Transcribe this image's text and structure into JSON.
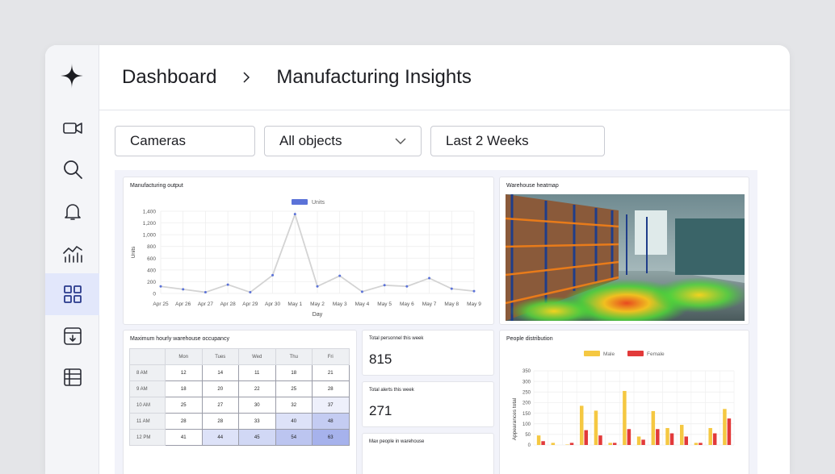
{
  "breadcrumb": {
    "root": "Dashboard",
    "current": "Manufacturing Insights"
  },
  "filters": {
    "cameras": "Cameras",
    "objects": "All objects",
    "range": "Last 2 Weeks"
  },
  "sidebar": {
    "icons": [
      "camera-icon",
      "search-icon",
      "bell-icon",
      "analytics-icon",
      "grid-icon",
      "archive-icon",
      "table-icon"
    ],
    "active": "grid-icon"
  },
  "colors": {
    "active_bg": "#e2e7fb",
    "line_series": "#d3d3d3",
    "point": "#5b72d8",
    "male": "#f5c842",
    "female": "#e23a3a"
  },
  "cards": {
    "output_title": "Manufacturing output",
    "heatmap_title": "Warehouse heatmap",
    "occupancy_title": "Maximum hourly warehouse occupancy",
    "personnel_title": "Total personnel this week",
    "personnel_value": "815",
    "alerts_title": "Total alerts this week",
    "alerts_value": "271",
    "maxpeople_title": "Max people in warehouse",
    "people_title": "People distribution"
  },
  "occupancy": {
    "days": [
      "Mon",
      "Tues",
      "Wed",
      "Thu",
      "Fri"
    ],
    "rows": [
      {
        "time": "8 AM",
        "values": [
          "12",
          "14",
          "11",
          "18",
          "21"
        ]
      },
      {
        "time": "9 AM",
        "values": [
          "18",
          "20",
          "22",
          "25",
          "28"
        ]
      },
      {
        "time": "10 AM",
        "values": [
          "25",
          "27",
          "30",
          "32",
          "37"
        ]
      },
      {
        "time": "11 AM",
        "values": [
          "28",
          "28",
          "33",
          "40",
          "48"
        ]
      },
      {
        "time": "12 PM",
        "values": [
          "41",
          "44",
          "45",
          "54",
          "63"
        ]
      }
    ]
  },
  "chart_data": [
    {
      "type": "line",
      "title": "",
      "legend": [
        "Units"
      ],
      "xlabel": "Day",
      "ylabel": "Units",
      "ylim": [
        0,
        1400
      ],
      "yticks": [
        "0",
        "200",
        "400",
        "600",
        "800",
        "1,000",
        "1,200",
        "1,400"
      ],
      "categories": [
        "Apr 25",
        "Apr 26",
        "Apr 27",
        "Apr 28",
        "Apr 29",
        "Apr 30",
        "May 1",
        "May 2",
        "May 3",
        "May 4",
        "May 5",
        "May 6",
        "May 7",
        "May 8",
        "May 9"
      ],
      "series": [
        {
          "name": "Units",
          "values": [
            120,
            70,
            20,
            150,
            20,
            310,
            1350,
            120,
            300,
            30,
            140,
            120,
            260,
            80,
            40
          ]
        }
      ],
      "grid": true,
      "legend_position": "top"
    },
    {
      "type": "bar",
      "title": "",
      "ylabel": "Appearances total",
      "ylim": [
        0,
        350
      ],
      "yticks": [
        "0",
        "50",
        "100",
        "150",
        "200",
        "250",
        "300",
        "350"
      ],
      "series": [
        {
          "name": "Male",
          "values": [
            45,
            10,
            2,
            185,
            162,
            10,
            255,
            40,
            160,
            80,
            95,
            10,
            80,
            170
          ]
        },
        {
          "name": "Female",
          "values": [
            18,
            0,
            10,
            70,
            45,
            10,
            75,
            25,
            75,
            55,
            40,
            10,
            55,
            125
          ]
        }
      ],
      "grid": true,
      "legend_position": "top"
    }
  ]
}
